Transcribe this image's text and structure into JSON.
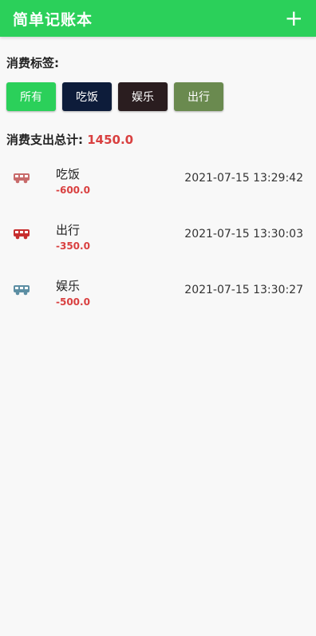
{
  "app": {
    "title": "简单记账本",
    "add_icon": "plus-icon",
    "add_label": "+"
  },
  "tags": {
    "label": "消费标签:",
    "items": [
      {
        "label": "所有",
        "color": "#2bd05a"
      },
      {
        "label": "吃饭",
        "color": "#0d1c3a"
      },
      {
        "label": "娱乐",
        "color": "#2a1d1f"
      },
      {
        "label": "出行",
        "color": "#6a8a4f"
      }
    ]
  },
  "total": {
    "label": "消费支出总计:",
    "value": "1450.0"
  },
  "records": [
    {
      "name": "吃饭",
      "amount": "-600.0",
      "time": "2021-07-15 13:29:42",
      "icon": "bus-icon",
      "icon_color": "#c86b6b"
    },
    {
      "name": "出行",
      "amount": "-350.0",
      "time": "2021-07-15 13:30:03",
      "icon": "bus-icon",
      "icon_color": "#c72e2e"
    },
    {
      "name": "娱乐",
      "amount": "-500.0",
      "time": "2021-07-15 13:30:27",
      "icon": "bus-icon",
      "icon_color": "#5c8ea3"
    }
  ]
}
